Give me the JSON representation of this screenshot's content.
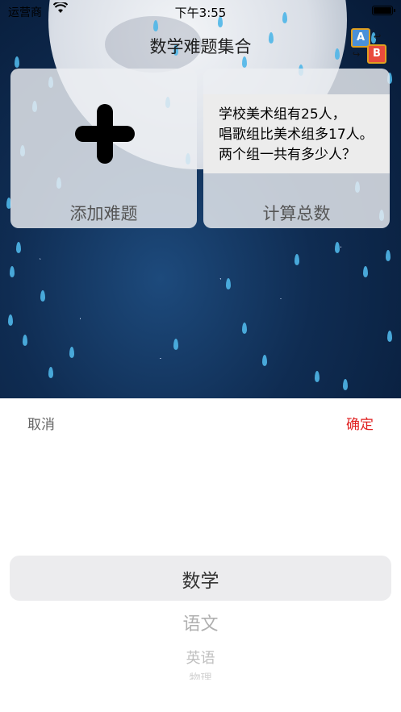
{
  "status_bar": {
    "carrier": "运营商",
    "wifi_icon": "wifi-icon",
    "time": "下午3:55",
    "battery_icon": "battery-icon"
  },
  "nav": {
    "title": "数学难题集合",
    "switch_icon": "a-b-switch-icon",
    "switch_a": "A",
    "switch_b": "B"
  },
  "cards": {
    "add": {
      "icon": "plus-icon",
      "label": "添加难题"
    },
    "calc": {
      "question_lines": [
        "学校美术组有25人，",
        "唱歌组比美术组多17人。",
        "两个组一共有多少人？"
      ],
      "label": "计算总数"
    }
  },
  "picker": {
    "cancel_label": "取消",
    "confirm_label": "确定",
    "confirm_color": "#e02020",
    "options": [
      "数学",
      "语文",
      "英语",
      "物理"
    ],
    "selected": "数学"
  },
  "colors": {
    "raindrop": "#4fb6e8"
  }
}
